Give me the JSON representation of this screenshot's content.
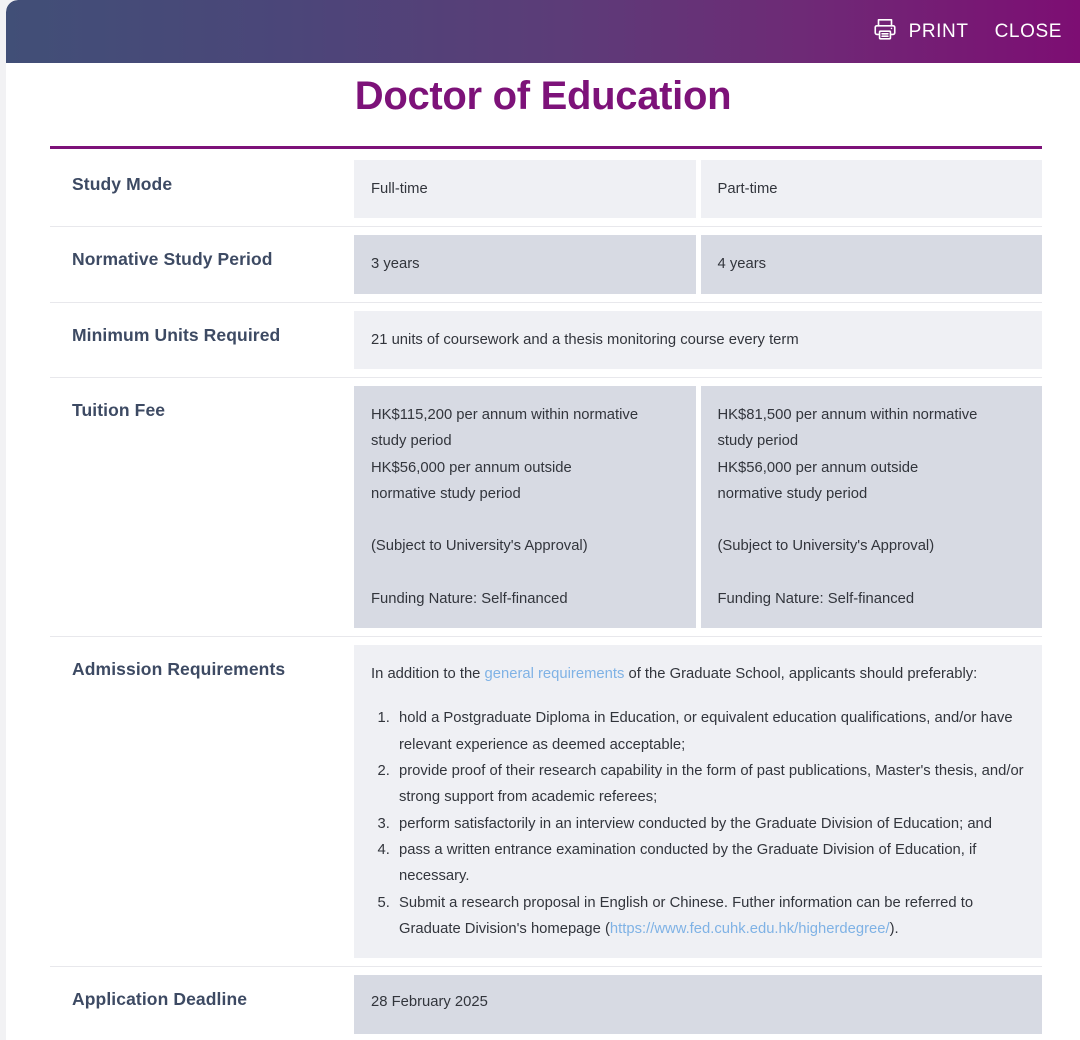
{
  "window": {
    "print_label": "PRINT",
    "close_label": "CLOSE",
    "printer_icon": "printer-icon"
  },
  "colors": {
    "accent_purple": "#7d1279",
    "label_navy": "#3d4a63",
    "link_blue": "#7fb2e5",
    "cell_light": "#eff0f4",
    "cell_dark": "#d7dae3",
    "header_gradient_start": "#414f77",
    "header_gradient_end": "#7d0e73"
  },
  "title": "Doctor of Education",
  "table": {
    "study_mode": {
      "label": "Study Mode",
      "full_time": "Full-time",
      "part_time": "Part-time"
    },
    "normative_study_period": {
      "label": "Normative Study Period",
      "full_time": "3 years",
      "part_time": "4 years"
    },
    "minimum_units": {
      "label": "Minimum Units Required",
      "value": "21 units of coursework and a thesis monitoring course every term"
    },
    "tuition_fee": {
      "label": "Tuition Fee",
      "full_time": {
        "line1": "HK$115,200 per annum within normative",
        "line2": "study period",
        "line3": "HK$56,000 per annum outside",
        "line4": "normative study period",
        "line5": "(Subject to University's Approval)",
        "line6": "Funding Nature: Self-financed"
      },
      "part_time": {
        "line1": "HK$81,500 per annum within normative",
        "line2": "study period",
        "line3": "HK$56,000 per annum outside",
        "line4": "normative study period",
        "line5": "(Subject to University's Approval)",
        "line6": "Funding Nature: Self-financed"
      }
    },
    "admission_requirements": {
      "label": "Admission Requirements",
      "intro_before_link": "In addition to the ",
      "intro_link": "general requirements",
      "intro_after_link": " of the Graduate School, applicants should preferably:",
      "items": [
        "hold a Postgraduate Diploma in Education, or equivalent education qualifications, and/or have relevant experience as deemed acceptable;",
        "provide proof of their research capability in the form of past publications, Master's thesis, and/or strong support from academic referees;",
        "perform satisfactorily in an interview conducted by the Graduate Division of Education; and",
        "pass a written entrance examination conducted by the Graduate Division of Education, if necessary."
      ],
      "item5_before_link": "Submit a research proposal in English or Chinese. Futher information can be referred to Graduate Division's homepage (",
      "item5_link": "https://www.fed.cuhk.edu.hk/higherdegree/",
      "item5_after_link": ")."
    },
    "application_deadline": {
      "label": "Application Deadline",
      "value": "28 February 2025"
    }
  }
}
